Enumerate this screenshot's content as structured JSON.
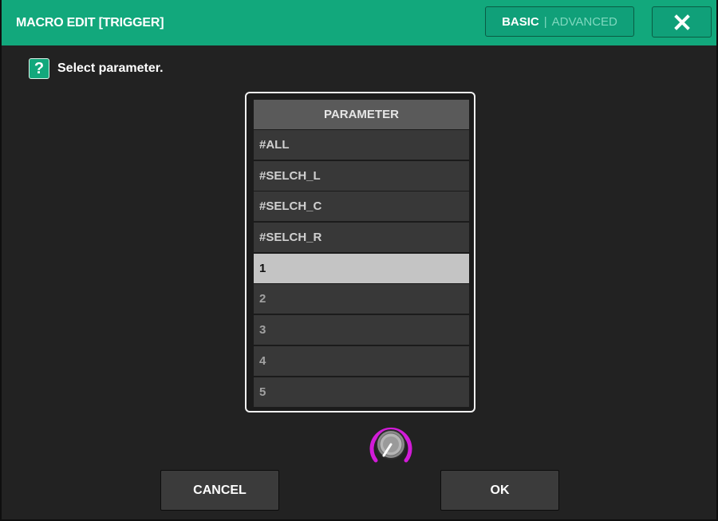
{
  "window": {
    "title": "MACRO EDIT [TRIGGER]",
    "mode_basic": "BASIC",
    "mode_separator": "|",
    "mode_advanced": "ADVANCED",
    "close_icon": "close-icon"
  },
  "prompt": {
    "icon": "?",
    "text": "Select parameter."
  },
  "list": {
    "header": "PARAMETER",
    "items": [
      {
        "label": "#ALL"
      },
      {
        "label": "#SELCH_L"
      },
      {
        "label": "#SELCH_C"
      },
      {
        "label": "#SELCH_R"
      },
      {
        "label": "1",
        "selected": true
      },
      {
        "label": "2"
      },
      {
        "label": "3"
      },
      {
        "label": "4"
      },
      {
        "label": "5"
      }
    ]
  },
  "buttons": {
    "cancel": "CANCEL",
    "ok": "OK"
  },
  "colors": {
    "titlebar": "#12a87c",
    "knob_ring": "#d21bd8",
    "selected_row": "#c4c4c4"
  }
}
